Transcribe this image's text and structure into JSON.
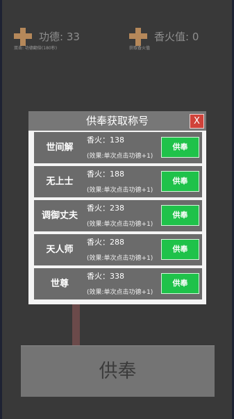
{
  "stats": {
    "merit": {
      "label": "功德: 33",
      "caption": "双击: 功德翻倍(180秒)"
    },
    "incense": {
      "label": "香火值: 0",
      "caption": "获取香火值"
    }
  },
  "main_button": {
    "label": "供奉"
  },
  "dialog": {
    "title": "供奉获取称号",
    "close_label": "X",
    "items": [
      {
        "name": "世间解",
        "price": "香火：138",
        "effect": "(效果:单次点击功德+1)",
        "button": "供奉"
      },
      {
        "name": "无上士",
        "price": "香火：188",
        "effect": "(效果:单次点击功德+1)",
        "button": "供奉"
      },
      {
        "name": "调御丈夫",
        "price": "香火：238",
        "effect": "(效果:单次点击功德+1)",
        "button": "供奉"
      },
      {
        "name": "天人师",
        "price": "香火：288",
        "effect": "(效果:单次点击功德+1)",
        "button": "供奉"
      },
      {
        "name": "世尊",
        "price": "香火：338",
        "effect": "(效果:单次点击功德+1)",
        "button": "供奉"
      }
    ]
  },
  "colors": {
    "background": "#393939",
    "dialog_header": "#777777",
    "row_background": "#6b6b6b",
    "offer_button": "#1fc24a",
    "close_button": "#d0423a",
    "icon_accent": "#b5885a"
  }
}
